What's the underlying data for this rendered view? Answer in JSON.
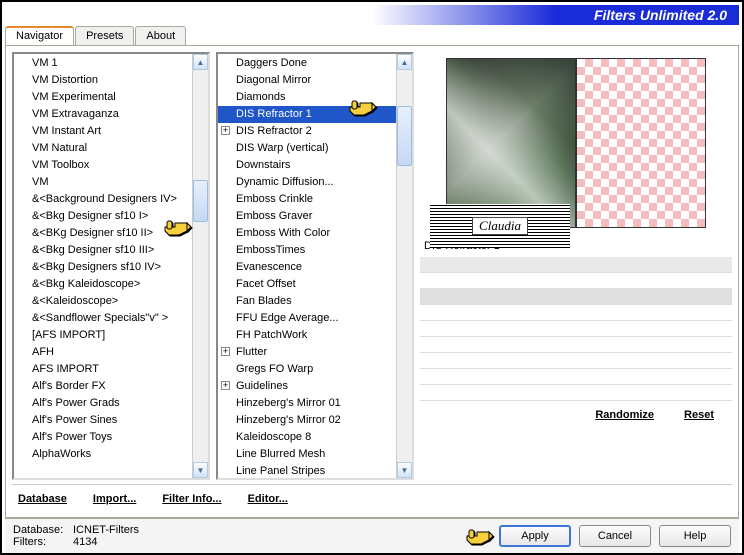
{
  "app": {
    "title": "Filters Unlimited 2.0"
  },
  "tabs": {
    "navigator": "Navigator",
    "presets": "Presets",
    "about": "About",
    "active": "navigator"
  },
  "left_list": {
    "items": [
      "VM 1",
      "VM Distortion",
      "VM Experimental",
      "VM Extravaganza",
      "VM Instant Art",
      "VM Natural",
      "VM Toolbox",
      "VM",
      "&<Background Designers IV>",
      "&<Bkg Designer sf10 I>",
      "&<BKg Designer sf10 II>",
      "&<Bkg Designer sf10 III>",
      "&<Bkg Designers sf10 IV>",
      "&<Bkg Kaleidoscope>",
      "&<Kaleidoscope>",
      "&<Sandflower Specials\"v\" >",
      "[AFS IMPORT]",
      "AFH",
      "AFS IMPORT",
      "Alf's Border FX",
      "Alf's Power Grads",
      "Alf's Power Sines",
      "Alf's Power Toys",
      "AlphaWorks"
    ],
    "highlight_index": 10
  },
  "right_list": {
    "items": [
      {
        "t": "Daggers Done"
      },
      {
        "t": "Diagonal Mirror"
      },
      {
        "t": "Diamonds"
      },
      {
        "t": "DIS Refractor 1",
        "sel": true
      },
      {
        "t": "DIS Refractor 2",
        "exp": true
      },
      {
        "t": "DIS Warp (vertical)"
      },
      {
        "t": "Downstairs"
      },
      {
        "t": "Dynamic Diffusion..."
      },
      {
        "t": "Emboss Crinkle"
      },
      {
        "t": "Emboss Graver"
      },
      {
        "t": "Emboss With Color"
      },
      {
        "t": "EmbossTimes"
      },
      {
        "t": "Evanescence"
      },
      {
        "t": "Facet Offset"
      },
      {
        "t": "Fan Blades"
      },
      {
        "t": "FFU Edge Average..."
      },
      {
        "t": "FH PatchWork"
      },
      {
        "t": "Flutter",
        "exp": true
      },
      {
        "t": "Gregs FO Warp"
      },
      {
        "t": "Guidelines",
        "exp": true
      },
      {
        "t": "Hinzeberg's Mirror 01"
      },
      {
        "t": "Hinzeberg's Mirror 02"
      },
      {
        "t": "Kaleidoscope 8"
      },
      {
        "t": "Line Blurred Mesh"
      },
      {
        "t": "Line Panel Stripes"
      }
    ]
  },
  "current_filter": {
    "name": "DIS Refractor 1"
  },
  "stamp": {
    "text": "Claudia"
  },
  "link_buttons": {
    "database": "Database",
    "import": "Import...",
    "filter_info": "Filter Info...",
    "editor": "Editor...",
    "randomize": "Randomize",
    "reset": "Reset"
  },
  "meta": {
    "db_label": "Database:",
    "db_value": "ICNET-Filters",
    "filters_label": "Filters:",
    "filters_value": "4134"
  },
  "buttons": {
    "apply": "Apply",
    "cancel": "Cancel",
    "help": "Help"
  }
}
